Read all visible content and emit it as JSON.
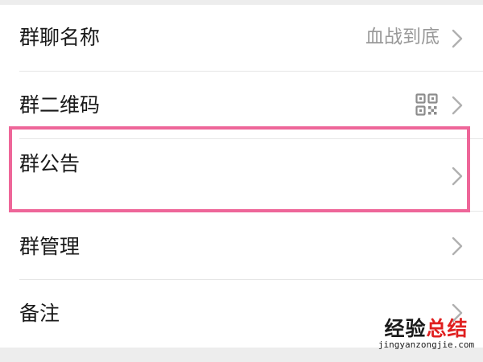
{
  "settings": {
    "items": [
      {
        "label": "群聊名称",
        "value": "血战到底"
      },
      {
        "label": "群二维码",
        "value": ""
      },
      {
        "label": "群公告",
        "value": ""
      },
      {
        "label": "群管理",
        "value": ""
      },
      {
        "label": "备注",
        "value": ""
      }
    ]
  },
  "icons": {
    "chevron": "chevron-right-icon",
    "qr": "qr-code-icon"
  },
  "colors": {
    "highlight": "#ee6699",
    "label": "#1a1a1a",
    "value": "#999999",
    "chevron": "#b0b0b0",
    "divider": "#e6e6e6",
    "background_strip": "#ededed",
    "watermark_accent": "#e02020"
  },
  "watermark": {
    "text_part1": "经验",
    "text_part2": "总结",
    "url": "jingyanzongjie.com"
  }
}
